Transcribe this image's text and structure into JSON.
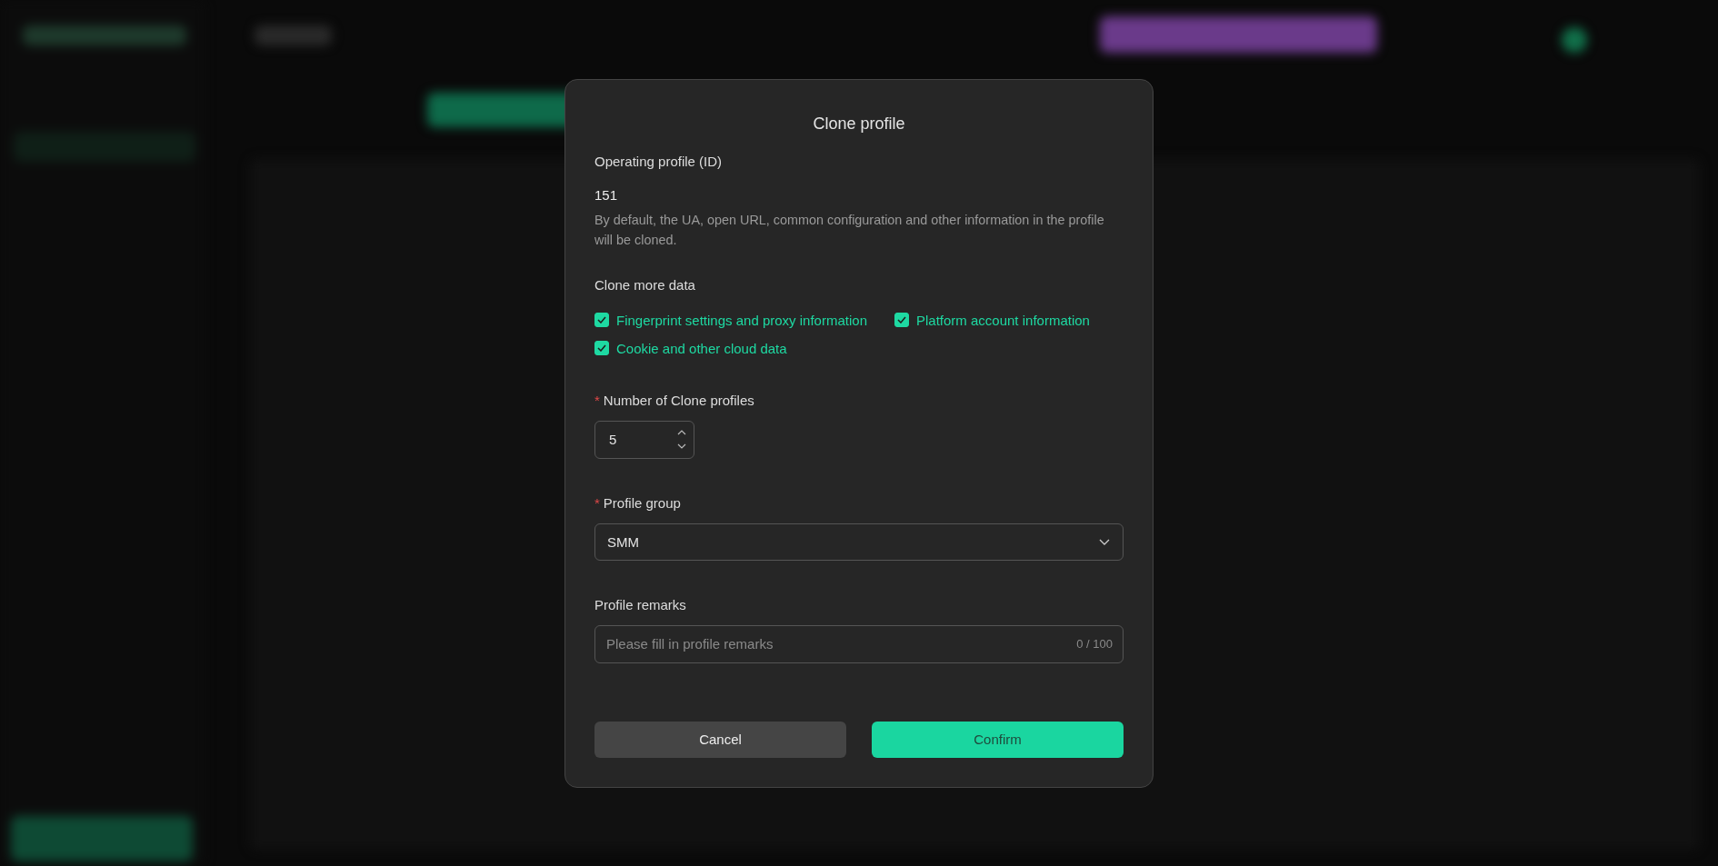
{
  "dialog": {
    "title": "Clone profile",
    "operating_profile": {
      "label": "Operating profile (ID)",
      "value": "151",
      "note": "By default, the UA, open URL, common configuration and other information in the profile will be cloned."
    },
    "clone_more": {
      "label": "Clone more data",
      "options": [
        {
          "label": "Fingerprint settings and proxy information",
          "checked": true
        },
        {
          "label": "Platform account information",
          "checked": true
        },
        {
          "label": "Cookie and other cloud data",
          "checked": true
        }
      ]
    },
    "clone_count": {
      "label": "Number of Clone profiles",
      "required_mark": "*",
      "value": "5"
    },
    "profile_group": {
      "label": "Profile group",
      "required_mark": "*",
      "value": "SMM"
    },
    "remarks": {
      "label": "Profile remarks",
      "placeholder": "Please fill in profile remarks",
      "counter": "0 / 100"
    },
    "buttons": [
      {
        "label": "Cancel",
        "kind": "secondary"
      },
      {
        "label": "Confirm",
        "kind": "primary"
      }
    ]
  }
}
